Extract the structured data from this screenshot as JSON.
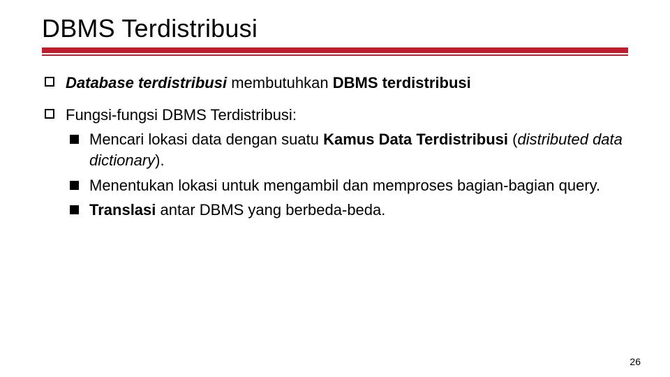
{
  "title": "DBMS Terdistribusi",
  "bullets": {
    "b1": {
      "s1": "Database terdistribusi",
      "s2": " membutuhkan ",
      "s3": "DBMS terdistribusi"
    },
    "b2": "Fungsi-fungsi DBMS Terdistribusi:"
  },
  "sub": {
    "a": {
      "s1": "Mencari lokasi data dengan suatu ",
      "s2": "Kamus Data Terdistribusi",
      "s3": " (",
      "s4": "distributed data dictionary",
      "s5": ")."
    },
    "b": "Menentukan lokasi untuk mengambil dan memproses bagian-bagian query.",
    "c": {
      "s1": "Translasi",
      "s2": " antar DBMS yang berbeda-beda."
    }
  },
  "page_number": "26"
}
